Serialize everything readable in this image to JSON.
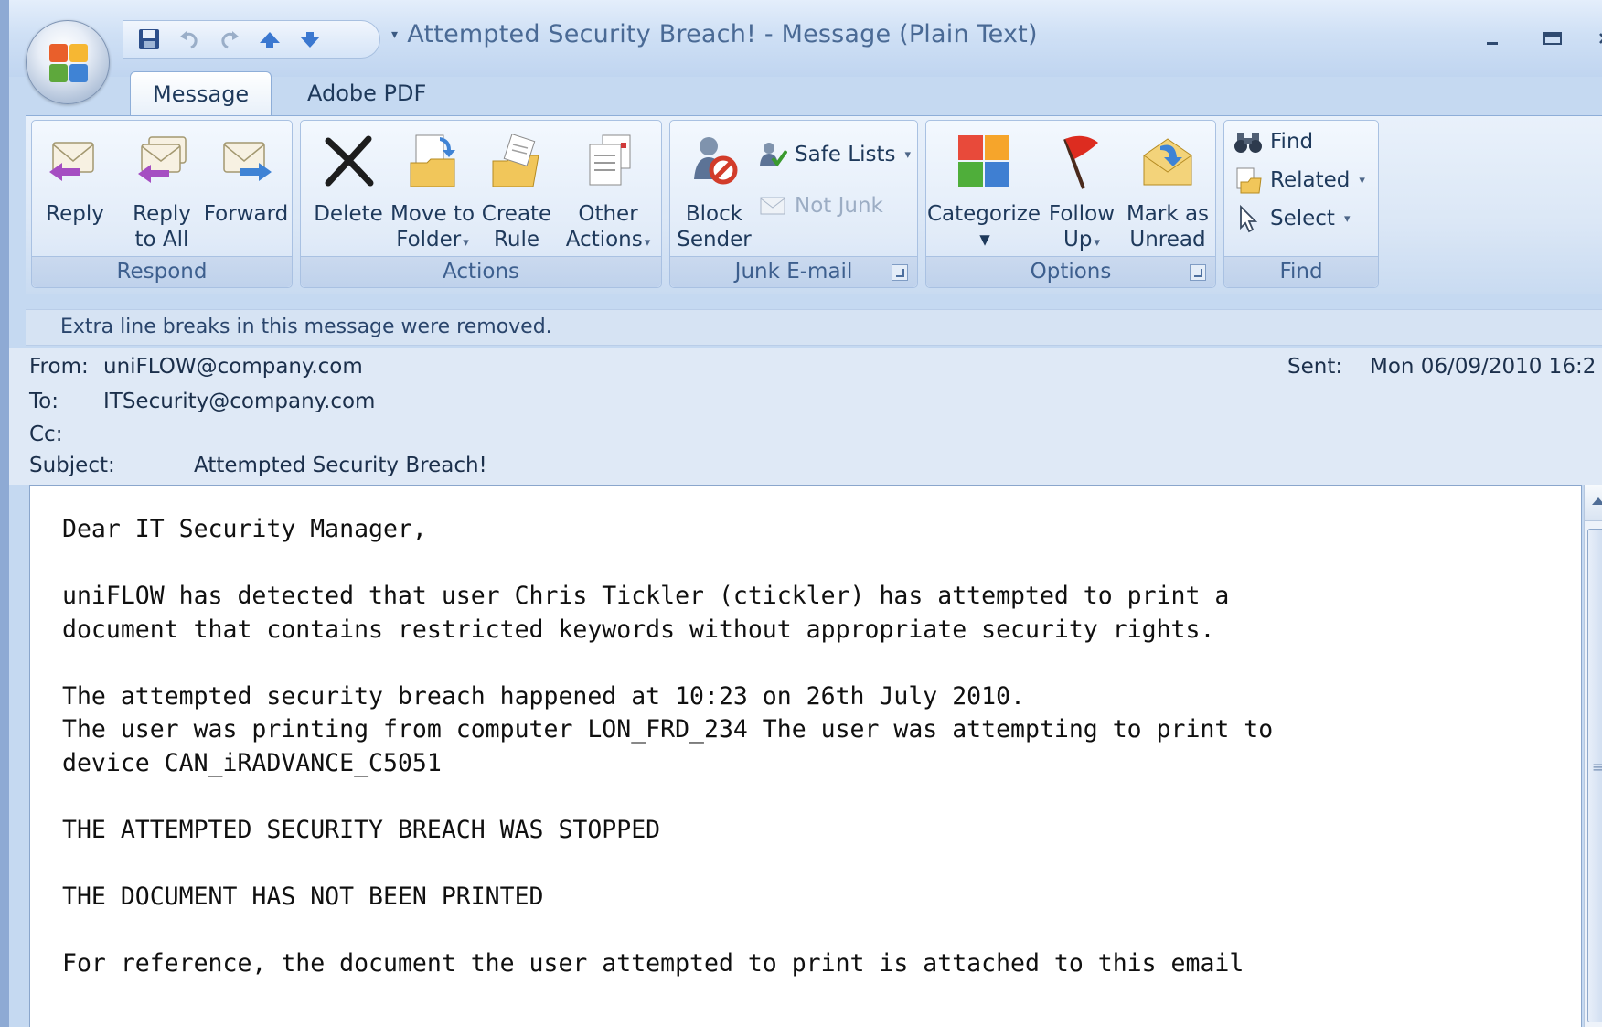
{
  "window": {
    "title": "Attempted Security Breach!  - Message (Plain Text)"
  },
  "tabs": [
    {
      "label": "Message"
    },
    {
      "label": "Adobe PDF"
    }
  ],
  "ribbon": {
    "respond": {
      "label": "Respond",
      "reply": "Reply",
      "reply_all_1": "Reply",
      "reply_all_2": "to All",
      "forward": "Forward"
    },
    "actions": {
      "label": "Actions",
      "delete": "Delete",
      "move_1": "Move to",
      "move_2": "Folder",
      "create_1": "Create",
      "create_2": "Rule",
      "other_1": "Other",
      "other_2": "Actions"
    },
    "junk": {
      "label": "Junk E-mail",
      "block_1": "Block",
      "block_2": "Sender",
      "safe_lists": "Safe Lists",
      "not_junk": "Not Junk"
    },
    "options": {
      "label": "Options",
      "categorize": "Categorize",
      "follow_1": "Follow",
      "follow_2": "Up",
      "mark_1": "Mark as",
      "mark_2": "Unread"
    },
    "find": {
      "label": "Find",
      "find": "Find",
      "related": "Related",
      "select": "Select"
    }
  },
  "infobar": "Extra line breaks in this message were removed.",
  "headers": {
    "from_label": "From:",
    "from_value": "uniFLOW@company.com",
    "sent_label": "Sent:",
    "sent_value": "Mon 06/09/2010 16:2",
    "to_label": "To:",
    "to_value": "ITSecurity@company.com",
    "cc_label": "Cc:",
    "subject_label": "Subject:",
    "subject_value": "Attempted Security Breach!"
  },
  "body": {
    "text": "Dear IT Security Manager,\n\nuniFLOW has detected that user Chris Tickler (ctickler) has attempted to print a\ndocument that contains restricted keywords without appropriate security rights.\n\nThe attempted security breach happened at 10:23 on 26th July 2010.\nThe user was printing from computer LON_FRD_234 The user was attempting to print to\ndevice CAN_iRADVANCE_C5051\n\nTHE ATTEMPTED SECURITY BREACH WAS STOPPED\n\nTHE DOCUMENT HAS NOT BEEN PRINTED\n\nFor reference, the document the user attempted to print is attached to this email"
  },
  "colors": {
    "ribbon_blue": "#dbe7f6",
    "group_label": "#3d5f8e",
    "title_text": "#4a6a95"
  }
}
